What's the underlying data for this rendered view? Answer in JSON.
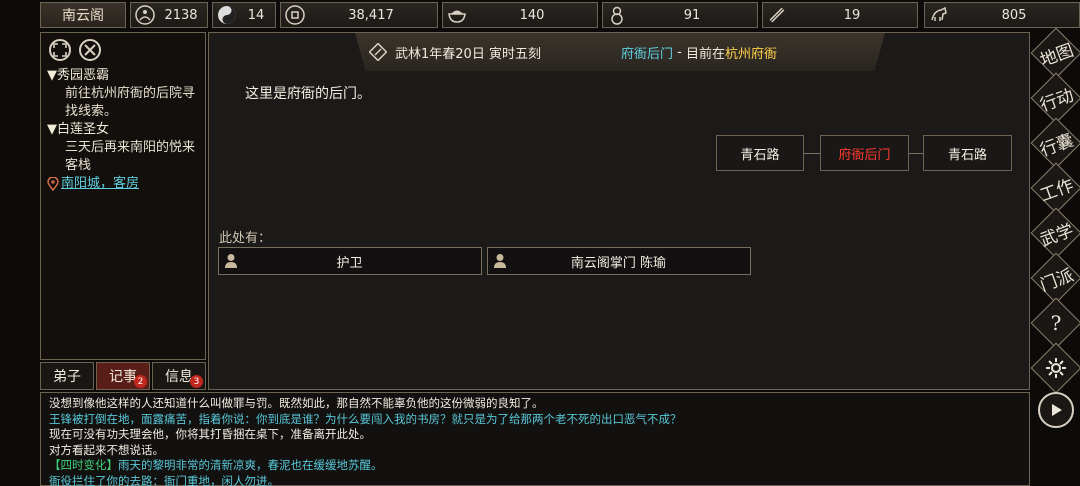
{
  "topbar": {
    "sect_name": "南云阁",
    "resources": [
      {
        "icon": "meditation-icon",
        "value": "2138"
      },
      {
        "icon": "yin-yang-icon",
        "value": "14"
      },
      {
        "icon": "coin-icon",
        "value": "38,417"
      },
      {
        "icon": "food-bowl-icon",
        "value": "140"
      },
      {
        "icon": "gourd-icon",
        "value": "91"
      },
      {
        "icon": "scroll-icon",
        "value": "19"
      },
      {
        "icon": "horse-icon",
        "value": "805"
      }
    ]
  },
  "quest_panel": {
    "quests": [
      {
        "title": "秀园恶霸",
        "desc_lines": [
          "前往杭州府衙的后院寻",
          "找线索。"
        ]
      },
      {
        "title": "白莲圣女",
        "desc_lines": [
          "三天后再来南阳的悦来",
          "客栈"
        ]
      }
    ],
    "location_link": "南阳城，客房",
    "tabs": [
      {
        "label": "弟子",
        "badge": ""
      },
      {
        "label": "记事",
        "badge": "2"
      },
      {
        "label": "信息",
        "badge": "3"
      }
    ]
  },
  "main": {
    "date": "武林1年春20日 寅时五刻",
    "location_name": "府衙后门",
    "separator": " - ",
    "current_prefix": "目前在",
    "current_city": "杭州府衙",
    "description": "这里是府衙的后门。",
    "map": {
      "left": "青石路",
      "center": "府衙后门",
      "right": "青石路"
    },
    "here_label": "此处有：",
    "npcs": [
      "护卫",
      "南云阁掌门 陈瑜"
    ]
  },
  "log": [
    {
      "text": "没想到像他这样的人还知道什么叫做罪与罚。既然如此，那自然不能辜负他的这份微弱的良知了。",
      "color": "#f0ece2"
    },
    {
      "text": "王锋被打倒在地，面露痛苦，指着你说：你到底是谁？为什么要闯入我的书房？就只是为了给那两个老不死的出口恶气不成？",
      "color": "#58c8d8"
    },
    {
      "text": "现在可没有功夫理会他，你将其打昏捆在桌下，准备离开此处。",
      "color": "#f0ece2"
    },
    {
      "text": "对方看起来不想说话。",
      "color": "#f0ece2"
    },
    {
      "tag": "【四时变化】",
      "text": "雨天的黎明非常的清新凉爽，春泥也在缓缓地苏醒。",
      "color": "#58c8d8",
      "tag_color": "#3fd07a"
    },
    {
      "text": "衙役拦住了你的去路：衙门重地，闲人勿进。",
      "color": "#58c8d8"
    }
  ],
  "right_menu": [
    "地图",
    "行动",
    "行囊",
    "工作",
    "武学",
    "门派",
    "?",
    "settings",
    "play"
  ],
  "colors": {
    "accent_red": "#ff3b30",
    "cyan": "#58c8d8",
    "gold": "#ffd24a",
    "panel_border": "#6e6252"
  }
}
